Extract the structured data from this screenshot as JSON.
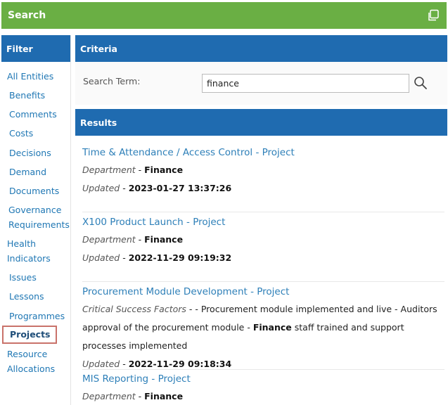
{
  "header": {
    "title": "Search",
    "copy_icon": "copy-icon"
  },
  "sidebar": {
    "title": "Filter",
    "items": [
      {
        "label": "All Entities"
      },
      {
        "label": "Benefits"
      },
      {
        "label": "Comments"
      },
      {
        "label": "Costs"
      },
      {
        "label": "Decisions"
      },
      {
        "label": "Demand"
      },
      {
        "label": "Documents"
      },
      {
        "label": "Governance Requirements"
      },
      {
        "label": "Health Indicators"
      },
      {
        "label": "Issues"
      },
      {
        "label": "Lessons"
      },
      {
        "label": "Programmes"
      },
      {
        "label": "Projects"
      },
      {
        "label": "Resource Allocations"
      }
    ],
    "active_item": "Projects"
  },
  "criteria": {
    "title": "Criteria",
    "search_label": "Search Term:",
    "search_value": "finance"
  },
  "results": {
    "title": "Results",
    "items": [
      {
        "title": "Time & Attendance / Access Control - Project",
        "dept_label": "Department",
        "dept_value": "Finance",
        "updated_label": "Updated",
        "updated_value": "2023-01-27 13:37:26"
      },
      {
        "title": "X100 Product Launch - Project",
        "dept_label": "Department",
        "dept_value": "Finance",
        "updated_label": "Updated",
        "updated_value": "2022-11-29 09:19:32"
      },
      {
        "title": "Procurement Module Development - Project",
        "csf_label": "Critical Success Factors",
        "csf_text_1": " - - Procurement module implemented and live - Auditors approval of the procurement module - ",
        "csf_bold": "Finance",
        "csf_text_2": " staff trained and support processes implemented",
        "updated_label": "Updated",
        "updated_value": "2022-11-29 09:18:34"
      },
      {
        "title": "MIS Reporting - Project",
        "dept_label": "Department",
        "dept_value": "Finance"
      }
    ]
  }
}
